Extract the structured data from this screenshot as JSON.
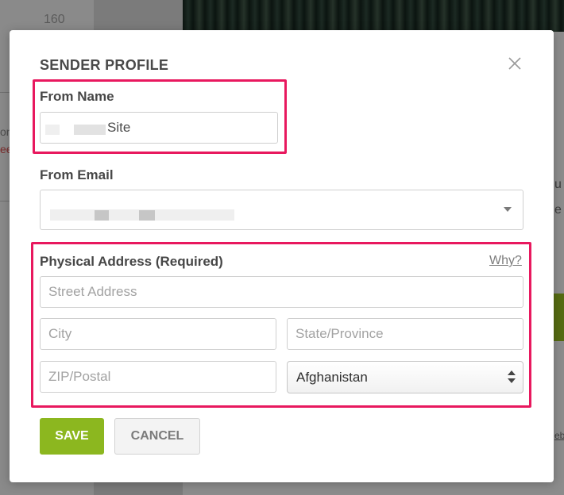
{
  "background": {
    "number_text": "160",
    "left_snippets": [
      "on",
      "ee"
    ],
    "right_snippets": [
      "u",
      "e"
    ],
    "link_snippet": "eb"
  },
  "modal": {
    "title": "SENDER PROFILE",
    "close_icon": "close-icon",
    "from_name": {
      "label": "From Name",
      "value_visible_suffix": "Site"
    },
    "from_email": {
      "label": "From Email",
      "dropdown_icon": "chevron-down-icon"
    },
    "physical_address": {
      "label": "Physical Address (Required)",
      "why_link": "Why?",
      "street_placeholder": "Street Address",
      "city_placeholder": "City",
      "state_placeholder": "State/Province",
      "zip_placeholder": "ZIP/Postal",
      "country_selected": "Afghanistan"
    },
    "buttons": {
      "save": "SAVE",
      "cancel": "CANCEL"
    }
  },
  "colors": {
    "highlight": "#e8185e",
    "save_button": "#8cb71f",
    "overlay": "#8c8c8c"
  }
}
